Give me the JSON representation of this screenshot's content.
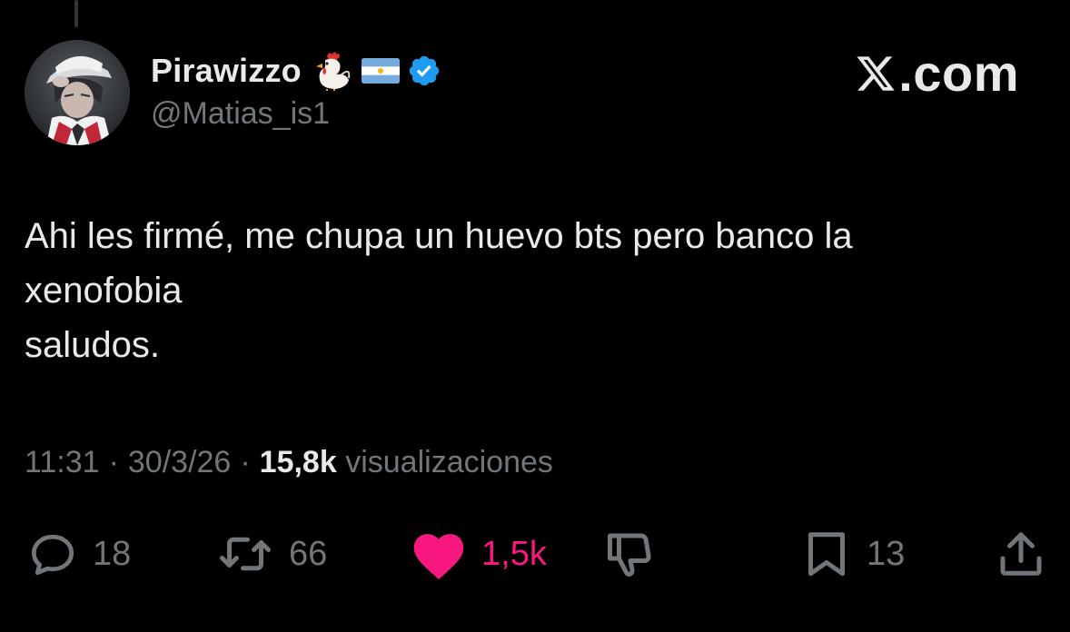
{
  "tweet": {
    "display_name": "Pirawizzo",
    "handle": "@Matias_is1",
    "brand": ".com",
    "text": "Ahi les firmé, me chupa un huevo bts pero banco la\nxenofobia\nsaludos.",
    "time": "11:31",
    "date": "30/3/26",
    "separator": "·",
    "views_count": "15,8k",
    "views_label": "visualizaciones",
    "name_emojis": [
      "rooster-icon",
      "argentina-flag-icon",
      "verified-badge-icon"
    ]
  },
  "actions": {
    "replies": "18",
    "reposts": "66",
    "likes": "1,5k",
    "bookmarks": "13"
  },
  "colors": {
    "background": "#000000",
    "text_primary": "#e7e9ea",
    "text_secondary": "#71767b",
    "like_pink": "#f91880",
    "verified_blue": "#1d9bf0"
  }
}
